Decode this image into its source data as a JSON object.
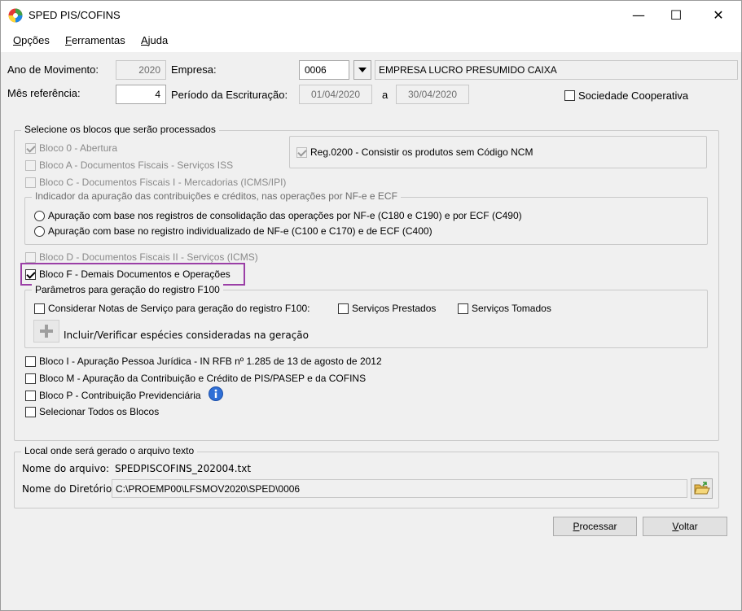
{
  "window": {
    "title": "SPED PIS/COFINS",
    "minimize": "—",
    "maximize": "☐",
    "close": "✕"
  },
  "menu": [
    {
      "label": "Opções",
      "mnemonic": "O",
      "rest": "pções"
    },
    {
      "label": "Ferramentas",
      "mnemonic": "F",
      "rest": "erramentas"
    },
    {
      "label": "Ajuda",
      "mnemonic": "A",
      "rest": "juda"
    }
  ],
  "header": {
    "ano_label": "Ano de Movimento:",
    "ano_value": "2020",
    "empresa_label": "Empresa:",
    "empresa_code": "0006",
    "empresa_name": "EMPRESA LUCRO PRESUMIDO CAIXA",
    "mes_label": "Mês referência:",
    "mes_value": "4",
    "periodo_label": "Período da Escrituração:",
    "periodo_inicio": "01/04/2020",
    "periodo_sep": "a",
    "periodo_fim": "30/04/2020",
    "sociedade_label": "Sociedade Cooperativa"
  },
  "blocos": {
    "legend": "Selecione os blocos que serão processados",
    "bloco0": "Bloco 0 - Abertura",
    "blocoA": "Bloco A - Documentos Fiscais - Serviços  ISS",
    "blocoC": "Bloco C - Documentos Fiscais  I - Mercadorias  (ICMS/IPI)",
    "reg0200": "Reg.0200 - Consistir os produtos sem Código NCM",
    "indicador_legend": "Indicador da apuração das contribuições e créditos, nas operações por NF-e e ECF",
    "radio1": "Apuração com base nos registros de consolidação das operações por  NF-e (C180 e C190) e por  ECF (C490)",
    "radio2": "Apuração com base no registro individualizado de NF-e (C100 e C170) e de ECF (C400)",
    "blocoD": "Bloco D - Documentos Fiscais II - Serviços  (ICMS)",
    "blocoF": "Bloco F - Demais Documentos e Operações",
    "f100_legend": "Parâmetros para geração do registro F100",
    "considerar": "Considerar Notas de Serviço para geração do registro F100:",
    "prestados": "Serviços Prestados",
    "tomados": "Serviços Tomados",
    "incluir": "Incluir/Verificar espécies consideradas na geração",
    "blocoI": "Bloco I - Apuração Pessoa Jurídica - IN RFB nº 1.285 de 13 de agosto de 2012",
    "blocoM": "Bloco M - Apuração da Contribuição e Crédito de PIS/PASEP e da COFINS",
    "blocoP": "Bloco P - Contribuição Previdenciária",
    "todos": "Selecionar Todos os Blocos"
  },
  "arquivo": {
    "legend": "Local onde será gerado o arquivo texto",
    "nome_label": "Nome do arquivo:",
    "nome_value": "SPEDPISCOFINS_202004.txt",
    "dir_label": "Nome do Diretório:",
    "dir_value": "C:\\PROEMP00\\LFSMOV2020\\SPED\\0006"
  },
  "buttons": {
    "processar": {
      "mnemonic": "P",
      "rest": "rocessar"
    },
    "voltar": {
      "mnemonic": "V",
      "rest": "oltar"
    }
  },
  "colors": {
    "highlight": "#9b3fa6",
    "info_icon": "#2f6fd6"
  }
}
